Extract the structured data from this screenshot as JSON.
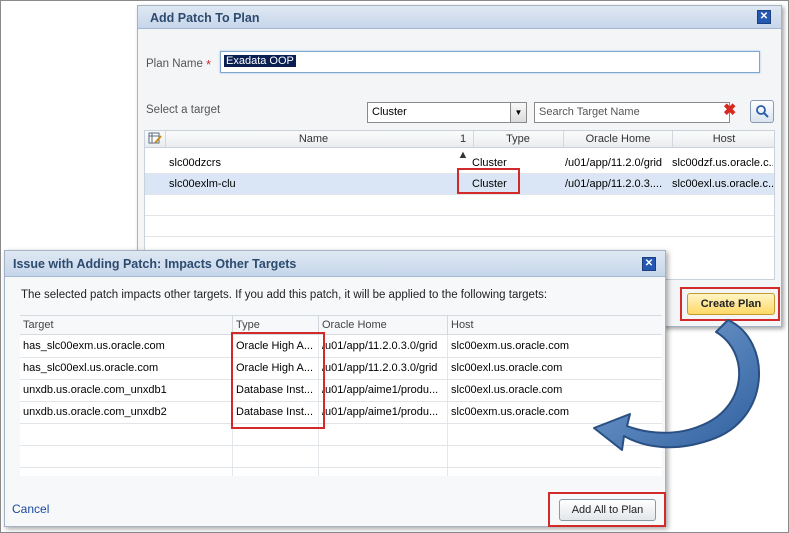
{
  "add_patch_dialog": {
    "title": "Add Patch To Plan",
    "plan_name_label": "Plan Name",
    "required_marker": "*",
    "plan_name_value": "Exadata OOP",
    "select_target_label": "Select a target",
    "target_type_selected": "Cluster",
    "search_placeholder": "Search Target Name",
    "columns": {
      "name": "Name",
      "sort": "1 ▲",
      "type": "Type",
      "oracle_home": "Oracle Home",
      "host": "Host"
    },
    "rows": [
      {
        "name": "slc00dzcrs",
        "type": "Cluster",
        "oracle_home": "/u01/app/11.2.0/grid",
        "host": "slc00dzf.us.oracle.c..."
      },
      {
        "name": "slc00exlm-clu",
        "type": "Cluster",
        "oracle_home": "/u01/app/11.2.0.3....",
        "host": "slc00exl.us.oracle.c..."
      }
    ],
    "create_plan_label": "Create Plan"
  },
  "issue_dialog": {
    "title": "Issue with Adding Patch: Impacts Other Targets",
    "message": "The selected patch impacts other targets. If you add this patch, it will be applied to the following targets:",
    "columns": {
      "target": "Target",
      "type": "Type",
      "oracle_home": "Oracle Home",
      "host": "Host"
    },
    "rows": [
      {
        "target": "has_slc00exm.us.oracle.com",
        "type": "Oracle High A...",
        "oracle_home": "/u01/app/11.2.0.3.0/grid",
        "host": "slc00exm.us.oracle.com"
      },
      {
        "target": "has_slc00exl.us.oracle.com",
        "type": "Oracle High A...",
        "oracle_home": "/u01/app/11.2.0.3.0/grid",
        "host": "slc00exl.us.oracle.com"
      },
      {
        "target": "unxdb.us.oracle.com_unxdb1",
        "type": "Database Inst...",
        "oracle_home": "/u01/app/aime1/produ...",
        "host": "slc00exl.us.oracle.com"
      },
      {
        "target": "unxdb.us.oracle.com_unxdb2",
        "type": "Database Inst...",
        "oracle_home": "/u01/app/aime1/produ...",
        "host": "slc00exm.us.oracle.com"
      }
    ],
    "cancel_label": "Cancel",
    "add_all_label": "Add All to Plan"
  },
  "icons": {
    "close": "close-icon",
    "dropdown": "chevron-down-icon",
    "clear": "clear-icon",
    "search": "search-icon",
    "edit_columns": "edit-columns-icon",
    "flow_arrow": "curved-arrow-icon"
  },
  "colors": {
    "highlight_box": "#d22a2a",
    "create_plan_button": "#ffd866",
    "title_text": "#2d4b6f",
    "link": "#1a4aa0"
  }
}
